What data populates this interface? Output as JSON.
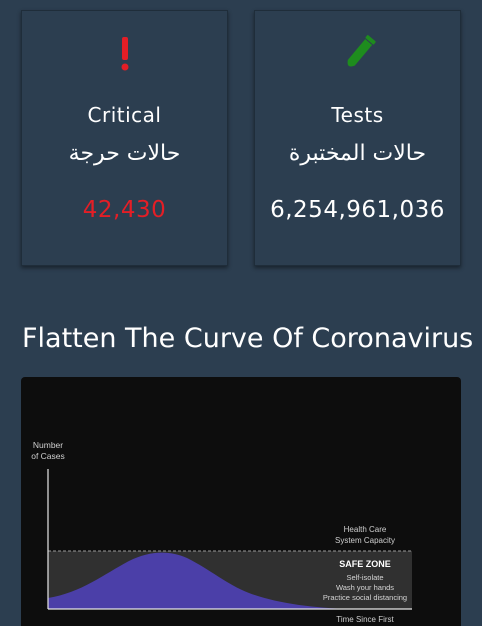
{
  "cards": {
    "critical": {
      "label_en": "Critical",
      "label_ar": "حالات حرجة",
      "value": "42,430",
      "icon": "exclamation-icon",
      "color": "#e41e26"
    },
    "tests": {
      "label_en": "Tests",
      "label_ar": "حالات المختبرة",
      "value": "6,254,961,036",
      "icon": "test-tube-icon",
      "color": "#1e8c1e"
    }
  },
  "section": {
    "title": "Flatten The Curve Of Coronavirus"
  },
  "graphic": {
    "y_axis_label_line1": "Number",
    "y_axis_label_line2": "of Cases",
    "capacity_label_line1": "Health Care",
    "capacity_label_line2": "System Capacity",
    "safe_zone_title": "SAFE ZONE",
    "safe_zone_item1": "Self-isolate",
    "safe_zone_item2": "Wash your hands",
    "safe_zone_item3": "Practice social distancing",
    "x_axis_label": "Time Since First"
  }
}
